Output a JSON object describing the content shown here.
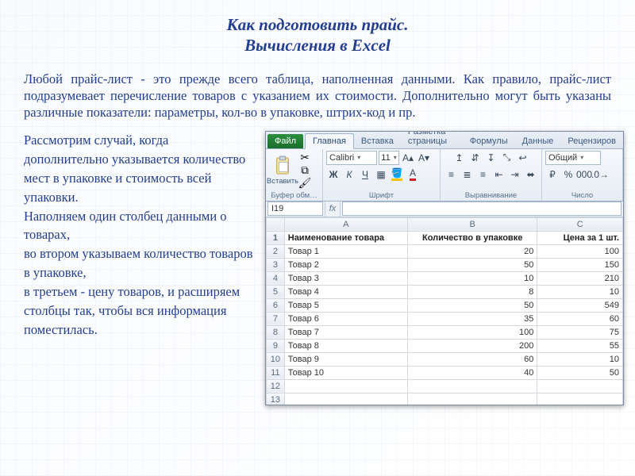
{
  "title_line1": "Как подготовить прайс.",
  "title_line2": "Вычисления в Excel",
  "intro": "Любой прайс-лист - это прежде всего таблица, наполненная данными. Как правило, прайс-лист подразумевает перечисление товаров с указанием их стоимости. Дополнительно могут быть указаны различные показатели: параметры, кол-во в упаковке, штрих-код и пр.",
  "lefttext": "Рассмотрим случай, когда дополнительно указывается количество мест в упаковке и стоимость всей упаковки.\nНаполняем один столбец данными о товарах,\nво втором указываем количество товаров в упаковке,\nв третьем - цену товаров, и расширяем столбцы так, чтобы вся информация поместилась.",
  "excel": {
    "tabs": {
      "file": "Файл",
      "items": [
        "Главная",
        "Вставка",
        "Разметка страницы",
        "Формулы",
        "Данные",
        "Рецензиров"
      ],
      "active_index": 0
    },
    "ribbon": {
      "clipboard": {
        "paste": "Вставить",
        "group": "Буфер обм…"
      },
      "font": {
        "name": "Calibri",
        "size": "11",
        "group": "Шрифт"
      },
      "align": {
        "group": "Выравнивание"
      },
      "number": {
        "format": "Общий",
        "group": "Число"
      }
    },
    "namebox": "I19",
    "fx_label": "fx",
    "columns": [
      "A",
      "B",
      "C"
    ],
    "header_row": [
      "Наименование товара",
      "Количество в упаковке",
      "Цена за 1 шт."
    ],
    "rows": [
      {
        "n": 1
      },
      {
        "n": 2,
        "a": "Товар 1",
        "b": 20,
        "c": 100
      },
      {
        "n": 3,
        "a": "Товар 2",
        "b": 50,
        "c": 150
      },
      {
        "n": 4,
        "a": "Товар 3",
        "b": 10,
        "c": 210
      },
      {
        "n": 5,
        "a": "Товар 4",
        "b": 8,
        "c": 10
      },
      {
        "n": 6,
        "a": "Товар 5",
        "b": 50,
        "c": 549
      },
      {
        "n": 7,
        "a": "Товар 6",
        "b": 35,
        "c": 60
      },
      {
        "n": 8,
        "a": "Товар 7",
        "b": 100,
        "c": 75
      },
      {
        "n": 9,
        "a": "Товар 8",
        "b": 200,
        "c": 55
      },
      {
        "n": 10,
        "a": "Товар 9",
        "b": 60,
        "c": 10
      },
      {
        "n": 11,
        "a": "Товар 10",
        "b": 40,
        "c": 50
      },
      {
        "n": 12
      },
      {
        "n": 13
      }
    ]
  }
}
